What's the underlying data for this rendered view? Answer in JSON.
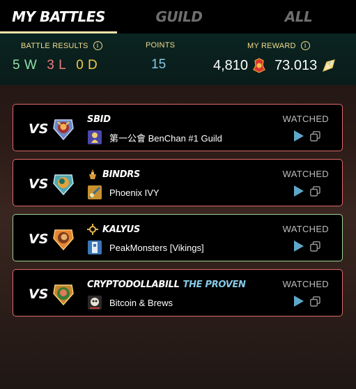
{
  "tabs": [
    {
      "label": "MY BATTLES",
      "active": true
    },
    {
      "label": "GUILD",
      "active": false
    },
    {
      "label": "ALL",
      "active": false
    }
  ],
  "summary": {
    "battle_results_label": "BATTLE RESULTS",
    "points_label": "POINTS",
    "reward_label": "MY REWARD",
    "wins": "5 W",
    "losses": "3 L",
    "draws": "0 D",
    "points": "15",
    "reward_dec": "4,810",
    "reward_sps": "73.013",
    "info_glyph": "i"
  },
  "battles": [
    {
      "vs": "VS",
      "player": "SBID",
      "title": "",
      "guild": "第一公會 BenChan #1 Guild",
      "status": "WATCHED",
      "result": "loss"
    },
    {
      "vs": "VS",
      "player": "BINDRS",
      "title": "",
      "guild": "Phoenix IVY",
      "status": "WATCHED",
      "result": "loss"
    },
    {
      "vs": "VS",
      "player": "KALYUS",
      "title": "",
      "guild": "PeakMonsters [Vikings]",
      "status": "WATCHED",
      "result": "win"
    },
    {
      "vs": "VS",
      "player": "CRYPTODOLLABILL",
      "title": "THE PROVEN",
      "guild": "Bitcoin & Brews",
      "status": "WATCHED",
      "result": "loss"
    }
  ],
  "colors": {
    "win_border": "#9fd38f",
    "loss_border": "#e06a6a",
    "accent_gold": "#f3dc8c",
    "play_blue": "#5fa7c9"
  },
  "icons": [
    "info-icon",
    "dec-icon",
    "sps-icon",
    "avatar-icon",
    "rank-icon",
    "guild-icon",
    "play-icon",
    "copy-icon"
  ]
}
